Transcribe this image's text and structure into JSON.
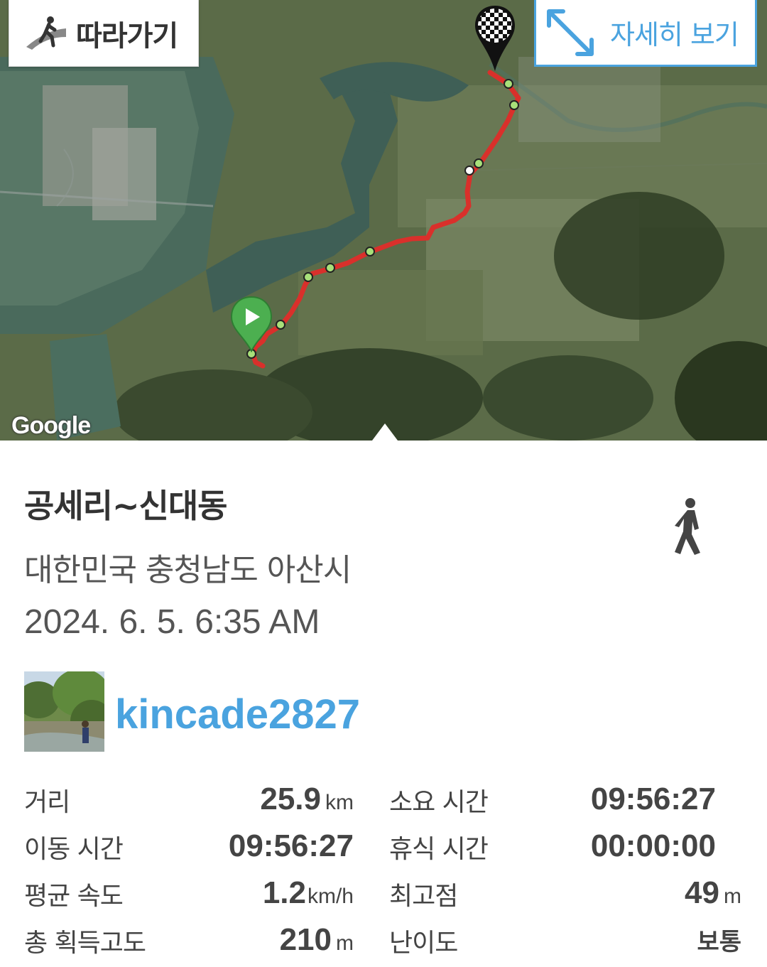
{
  "map": {
    "follow_label": "따라가기",
    "detail_label": "자세히 보기",
    "attribution": "Google",
    "colors": {
      "route": "#d9302b",
      "waypoint": "#a8e07a",
      "start_pin": "#4caf50",
      "accent": "#4aa3df"
    }
  },
  "track": {
    "title": "공세리~신대동",
    "region": "대한민국 충청남도 아산시",
    "datetime": "2024. 6. 5. 6:35 AM",
    "activity_icon": "walking-person-icon",
    "user": {
      "name": "kincade2827"
    }
  },
  "stats": {
    "distance": {
      "label": "거리",
      "value": "25.9",
      "unit": "km"
    },
    "total_time": {
      "label": "소요 시간",
      "value": "09:56:27"
    },
    "moving_time": {
      "label": "이동 시간",
      "value": "09:56:27"
    },
    "rest_time": {
      "label": "휴식 시간",
      "value": "00:00:00"
    },
    "avg_speed": {
      "label": "평균 속도",
      "value": "1.2",
      "unit": "km/h"
    },
    "max_elevation": {
      "label": "최고점",
      "value": "49",
      "unit": "m"
    },
    "total_ascent": {
      "label": "총 획득고도",
      "value": "210",
      "unit": "m"
    },
    "difficulty": {
      "label": "난이도",
      "value": "보통"
    }
  }
}
